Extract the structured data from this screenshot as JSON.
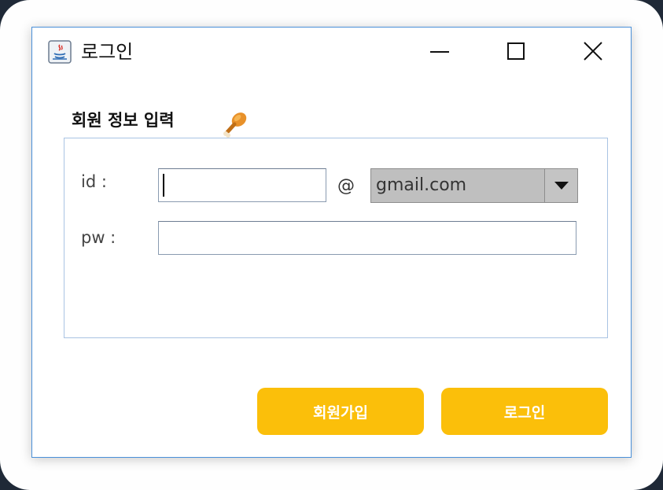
{
  "window": {
    "title": "로그인"
  },
  "form": {
    "section_title": "회원 정보 입력",
    "id_label": "id :",
    "pw_label": "pw :",
    "id_value": "",
    "pw_value": "",
    "at_sign": "@",
    "domain_selected": "gmail.com"
  },
  "buttons": {
    "signup_label": "회원가입",
    "login_label": "로그인"
  },
  "icons": {
    "app": "java-icon",
    "section": "drumstick-icon",
    "minimize": "minimize-icon",
    "maximize": "maximize-icon",
    "close": "close-icon",
    "dropdown": "chevron-down-icon"
  },
  "colors": {
    "accent": "#fbbf0a",
    "window_border": "#4a90d9",
    "panel_border": "#a9c3e3",
    "select_bg": "#bfbfbf"
  }
}
